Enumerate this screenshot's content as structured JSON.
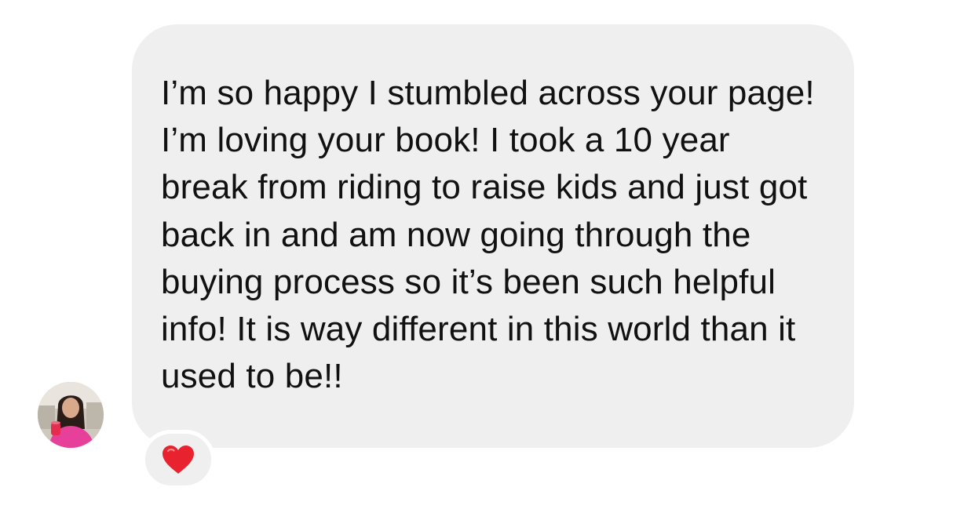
{
  "conversation": {
    "message": {
      "text": "I’m so happy I stumbled across your page! I’m loving your book! I took a 10 year break from riding to raise kids and just got back in and am now going through the buying process so it’s been such helpful info! It is way different in this world than it used to be!!",
      "reaction": "heart-emoji",
      "sender_avatar": "profile-photo",
      "bubble_color": "#efefef"
    }
  },
  "colors": {
    "background": "#ffffff",
    "text": "#111111",
    "heart": "#e8232f"
  }
}
